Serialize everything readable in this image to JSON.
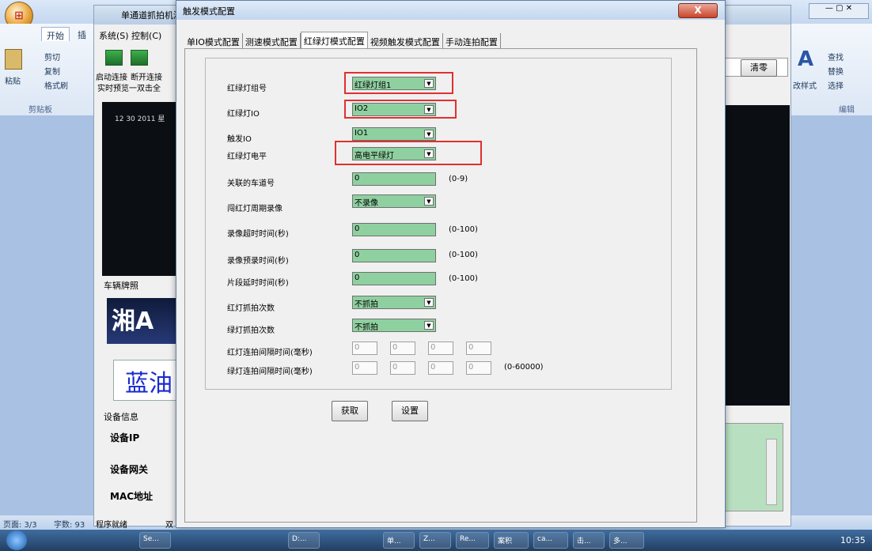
{
  "word": {
    "tab_home": "开始",
    "tab_insert": "插",
    "cut": "剪切",
    "copy": "复制",
    "paste": "粘贴",
    "format_painter": "格式刷",
    "clipboard_group": "剪贴板",
    "styles_label": "改样式",
    "find": "查找",
    "replace": "替换",
    "select": "选择",
    "edit_group": "编辑",
    "status_page": "页面: 3/3",
    "status_words": "字数: 93"
  },
  "app": {
    "title": "单通道抓拍机演示",
    "menu": "系统(S)  控制(C)",
    "btn_connect": "启动连接",
    "btn_disconnect": "断开连接",
    "preview_label": "实时预览一双击全",
    "timestamp": "12 30 2011 星",
    "plate_label": "车辆牌照",
    "plate_text": "湘A",
    "plate_color_text": "蓝油",
    "device_info": "设备信息",
    "device_ip": "设备IP",
    "device_gateway": "设备网关",
    "mac": "MAC地址",
    "status": "程序就绪",
    "status2": "双"
  },
  "right": {
    "clear_btn": "清零"
  },
  "dialog": {
    "title": "触发模式配置",
    "close": "X",
    "tabs": [
      "单IO模式配置",
      "测速模式配置",
      "红绿灯模式配置",
      "视频触发模式配置",
      "手动连拍配置"
    ],
    "fields": {
      "group_label": "红绿灯组号",
      "group_value": "红绿灯组1",
      "light_io_label": "红绿灯IO",
      "light_io_value": "IO2",
      "trigger_io_label": "触发IO",
      "trigger_io_value": "IO1",
      "level_label": "红绿灯电平",
      "level_value": "高电平绿灯",
      "lane_label": "关联的车道号",
      "lane_value": "0",
      "lane_range": "(0-9)",
      "red_record_label": "闯红灯周期录像",
      "red_record_value": "不录像",
      "rec_timeout_label": "录像超时时间(秒)",
      "rec_timeout_value": "0",
      "rec_timeout_range": "(0-100)",
      "rec_pre_label": "录像预录时间(秒)",
      "rec_pre_value": "0",
      "rec_pre_range": "(0-100)",
      "seg_delay_label": "片段延时时间(秒)",
      "seg_delay_value": "0",
      "seg_delay_range": "(0-100)",
      "red_shots_label": "红灯抓拍次数",
      "red_shots_value": "不抓拍",
      "green_shots_label": "绿灯抓拍次数",
      "green_shots_value": "不抓拍",
      "red_interval_label": "红灯连拍间隔时间(毫秒)",
      "green_interval_label": "绿灯连拍间隔时间(毫秒)",
      "interval_values": [
        "0",
        "0",
        "0",
        "0"
      ],
      "interval_range": "(0-60000)"
    },
    "get_btn": "获取",
    "set_btn": "设置"
  },
  "taskbar": {
    "time": "10:35",
    "items": [
      "Se...",
      "D:...",
      "单...",
      "Z...",
      "Re...",
      "案积",
      "ca...",
      "击...",
      "多..."
    ]
  },
  "colors": {
    "field_green": "#8fd0a0",
    "highlight_red": "#e03030"
  }
}
